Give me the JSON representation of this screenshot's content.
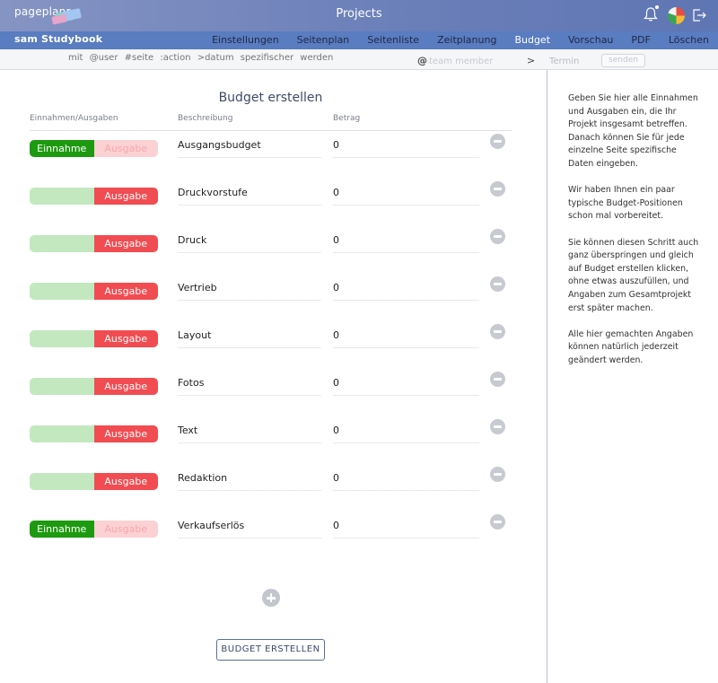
{
  "header": {
    "logo_text": "pageplanr",
    "app_title": "Projects"
  },
  "project_bar": {
    "project_name": "sam Studybook",
    "tabs": [
      {
        "label": "Einstellungen",
        "active": false
      },
      {
        "label": "Seitenplan",
        "active": false
      },
      {
        "label": "Seitenliste",
        "active": false
      },
      {
        "label": "Zeitplanung",
        "active": false
      },
      {
        "label": "Budget",
        "active": true
      },
      {
        "label": "Vorschau",
        "active": false
      },
      {
        "label": "PDF",
        "active": false
      },
      {
        "label": "Löschen",
        "active": false
      }
    ]
  },
  "command_bar": {
    "hint": "mit @user #seite :action >datum spezifischer werden",
    "at_symbol": "@",
    "member_placeholder": "team member",
    "gt_symbol": ">",
    "termin_label": "Termin",
    "send_label": "senden"
  },
  "budget": {
    "title": "Budget erstellen",
    "col_type": "Einnahmen/Ausgaben",
    "col_desc": "Beschreibung",
    "col_amount": "Betrag",
    "einnahme_label": "Einnahme",
    "ausgabe_label": "Ausgabe",
    "rows": [
      {
        "type": "Einnahme",
        "description": "Ausgangsbudget",
        "amount": "0"
      },
      {
        "type": "Ausgabe",
        "description": "Druckvorstufe",
        "amount": "0"
      },
      {
        "type": "Ausgabe",
        "description": "Druck",
        "amount": "0"
      },
      {
        "type": "Ausgabe",
        "description": "Vertrieb",
        "amount": "0"
      },
      {
        "type": "Ausgabe",
        "description": "Layout",
        "amount": "0"
      },
      {
        "type": "Ausgabe",
        "description": "Fotos",
        "amount": "0"
      },
      {
        "type": "Ausgabe",
        "description": "Text",
        "amount": "0"
      },
      {
        "type": "Ausgabe",
        "description": "Redaktion",
        "amount": "0"
      },
      {
        "type": "Einnahme",
        "description": "Verkaufserlös",
        "amount": "0"
      }
    ],
    "create_button": "BUDGET ERSTELLEN"
  },
  "sidebar": {
    "paragraphs": [
      "Geben Sie hier alle Einnahmen und Ausgaben ein, die Ihr Projekt insgesamt betreffen. Danach können Sie für jede einzelne Seite spezifische Daten eingeben.",
      "Wir haben Ihnen ein paar typische Budget-Positionen schon mal vorbereitet.",
      "Sie können diesen Schritt auch ganz überspringen und gleich auf Budget erstellen klicken, ohne etwas auszufüllen, und Angaben zum Gesamtprojekt erst später machen.",
      "Alle hier gemachten Angaben können natürlich jederzeit geändert werden."
    ]
  },
  "colors": {
    "einnahme_on": "#1d9a0f",
    "ausgabe_on": "#f14c51",
    "header_accent": "#5a7cc0"
  }
}
